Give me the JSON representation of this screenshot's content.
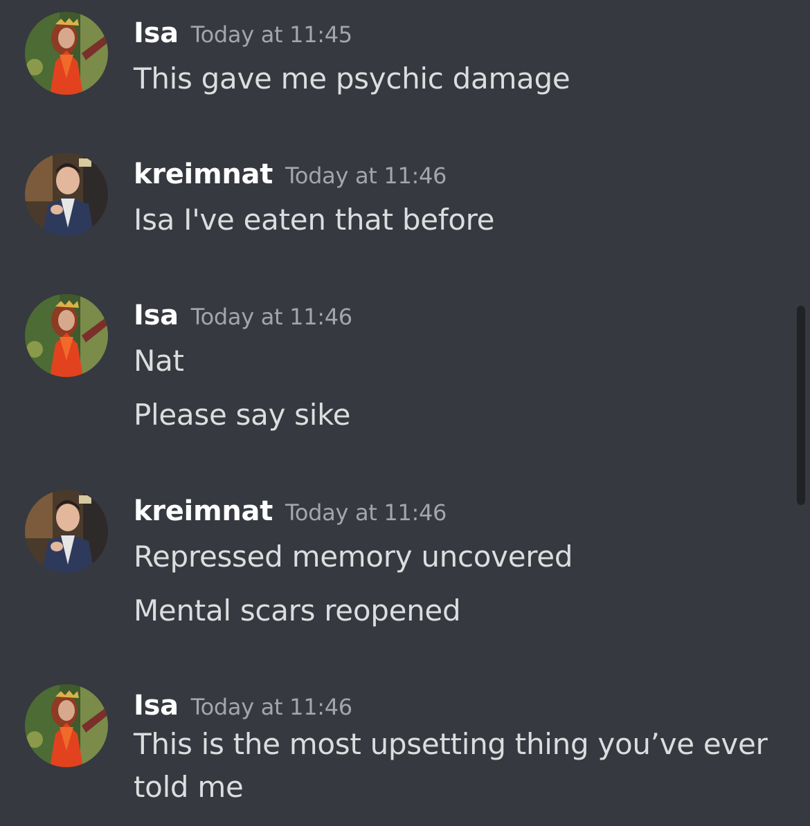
{
  "colors": {
    "background": "#36393f",
    "username": "#ffffff",
    "timestamp": "#a3a6aa",
    "message_text": "#dcddde",
    "scrollbar": "#202225"
  },
  "messages": [
    {
      "username": "Isa",
      "timestamp": "Today at 11:45",
      "avatar": "isa-avatar",
      "lines": [
        "This gave me psychic damage"
      ]
    },
    {
      "username": "kreimnat",
      "timestamp": "Today at 11:46",
      "avatar": "kreimnat-avatar",
      "lines": [
        "Isa I've eaten that before"
      ]
    },
    {
      "username": "Isa",
      "timestamp": "Today at 11:46",
      "avatar": "isa-avatar",
      "lines": [
        "Nat",
        "Please say sike"
      ]
    },
    {
      "username": "kreimnat",
      "timestamp": "Today at 11:46",
      "avatar": "kreimnat-avatar",
      "lines": [
        "Repressed memory uncovered",
        "Mental scars reopened"
      ]
    },
    {
      "username": "Isa",
      "timestamp": "Today at 11:46",
      "avatar": "isa-avatar",
      "lines": [
        "This is the most upsetting thing you’ve ever",
        "told me"
      ]
    }
  ]
}
